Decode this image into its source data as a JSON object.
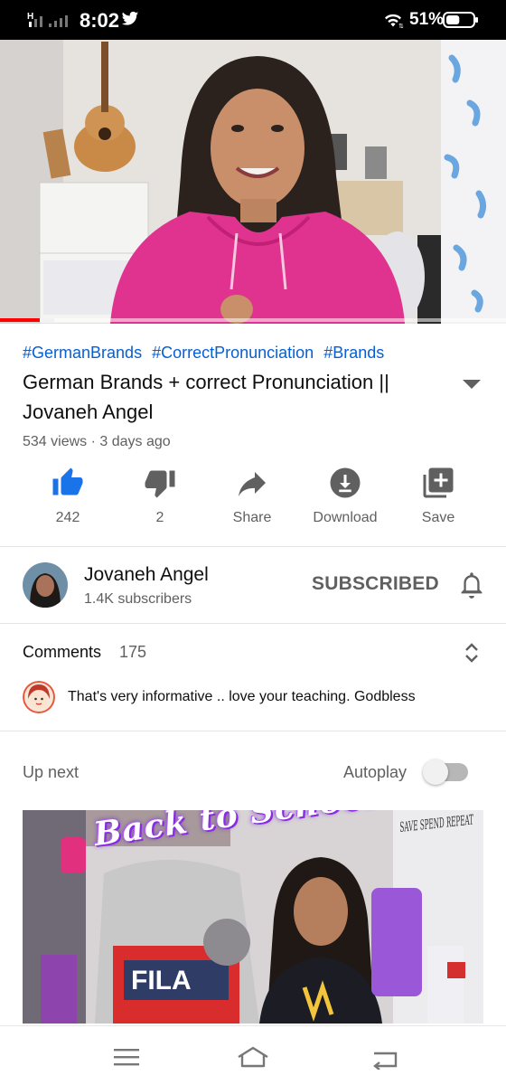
{
  "status_bar": {
    "network_label": "H",
    "time": "8:02",
    "battery_percent": "51%",
    "battery_level": 0.51
  },
  "player": {
    "progress_fraction": 0.08
  },
  "video": {
    "hashtags": [
      "#GermanBrands",
      "#CorrectPronunciation",
      "#Brands"
    ],
    "title_line1": "German Brands + correct Pronunciation ||",
    "title_line2": "Jovaneh Angel",
    "meta": "534 views · 3 days ago"
  },
  "actions": {
    "like_count": "242",
    "dislike_count": "2",
    "share_label": "Share",
    "download_label": "Download",
    "save_label": "Save"
  },
  "channel": {
    "name": "Jovaneh Angel",
    "subscribers": "1.4K subscribers",
    "subscribe_label": "SUBSCRIBED"
  },
  "comments": {
    "label": "Comments",
    "count": "175",
    "top_comment": "That's very informative .. love your teaching. Godbless"
  },
  "up_next": {
    "label": "Up next",
    "autoplay_label": "Autoplay",
    "autoplay_on": false,
    "thumbnail_title": "Back to School Haul",
    "thumbnail_side_text": "SAVE SPEND REPEAT",
    "thumbnail_brand": "FILA"
  },
  "colors": {
    "accent_blue": "#065fd4",
    "like_active": "#1a73e8",
    "progress_red": "#ff0000",
    "secondary_text": "#606060"
  }
}
